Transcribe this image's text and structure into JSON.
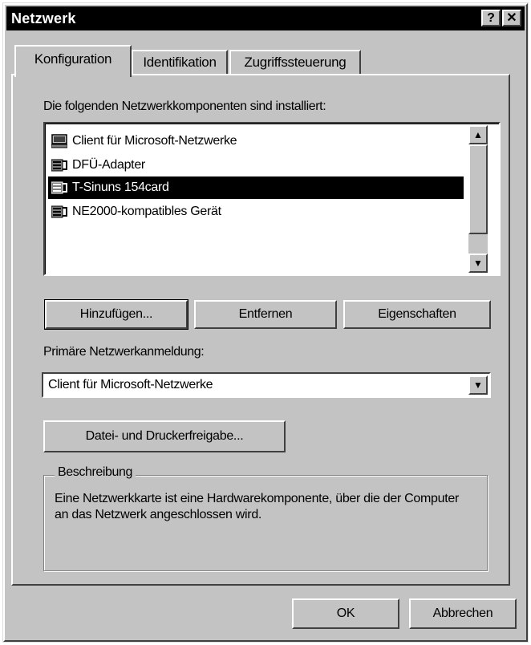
{
  "window": {
    "title": "Netzwerk",
    "help_label": "?",
    "close_label": "✕"
  },
  "tabs": [
    {
      "label": "Konfiguration",
      "active": true
    },
    {
      "label": "Identifikation",
      "active": false
    },
    {
      "label": "Zugriffssteuerung",
      "active": false
    }
  ],
  "components": {
    "label": "Die folgenden Netzwerkkomponenten sind installiert:",
    "items": [
      {
        "label": "Client für Microsoft-Netzwerke",
        "icon": "network-client-icon",
        "selected": false
      },
      {
        "label": "DFÜ-Adapter",
        "icon": "network-adapter-icon",
        "selected": false
      },
      {
        "label": "T-Sinuns 154card",
        "icon": "network-adapter-icon",
        "selected": true
      },
      {
        "label": "NE2000-kompatibles Gerät",
        "icon": "network-adapter-icon",
        "selected": false
      }
    ]
  },
  "buttons": {
    "add": "Hinzufügen...",
    "remove": "Entfernen",
    "properties": "Eigenschaften",
    "file_print": "Datei- und Druckerfreigabe...",
    "ok": "OK",
    "cancel": "Abbrechen"
  },
  "logon": {
    "label": "Primäre Netzwerkanmeldung:",
    "value": "Client für Microsoft-Netzwerke"
  },
  "description": {
    "legend": "Beschreibung",
    "text": "Eine Netzwerkkarte ist eine Hardwarekomponente, über die der Computer an das Netzwerk angeschlossen wird."
  },
  "colors": {
    "face": "#c3c3c3",
    "selection": "#000000",
    "titlebar": "#000000"
  }
}
